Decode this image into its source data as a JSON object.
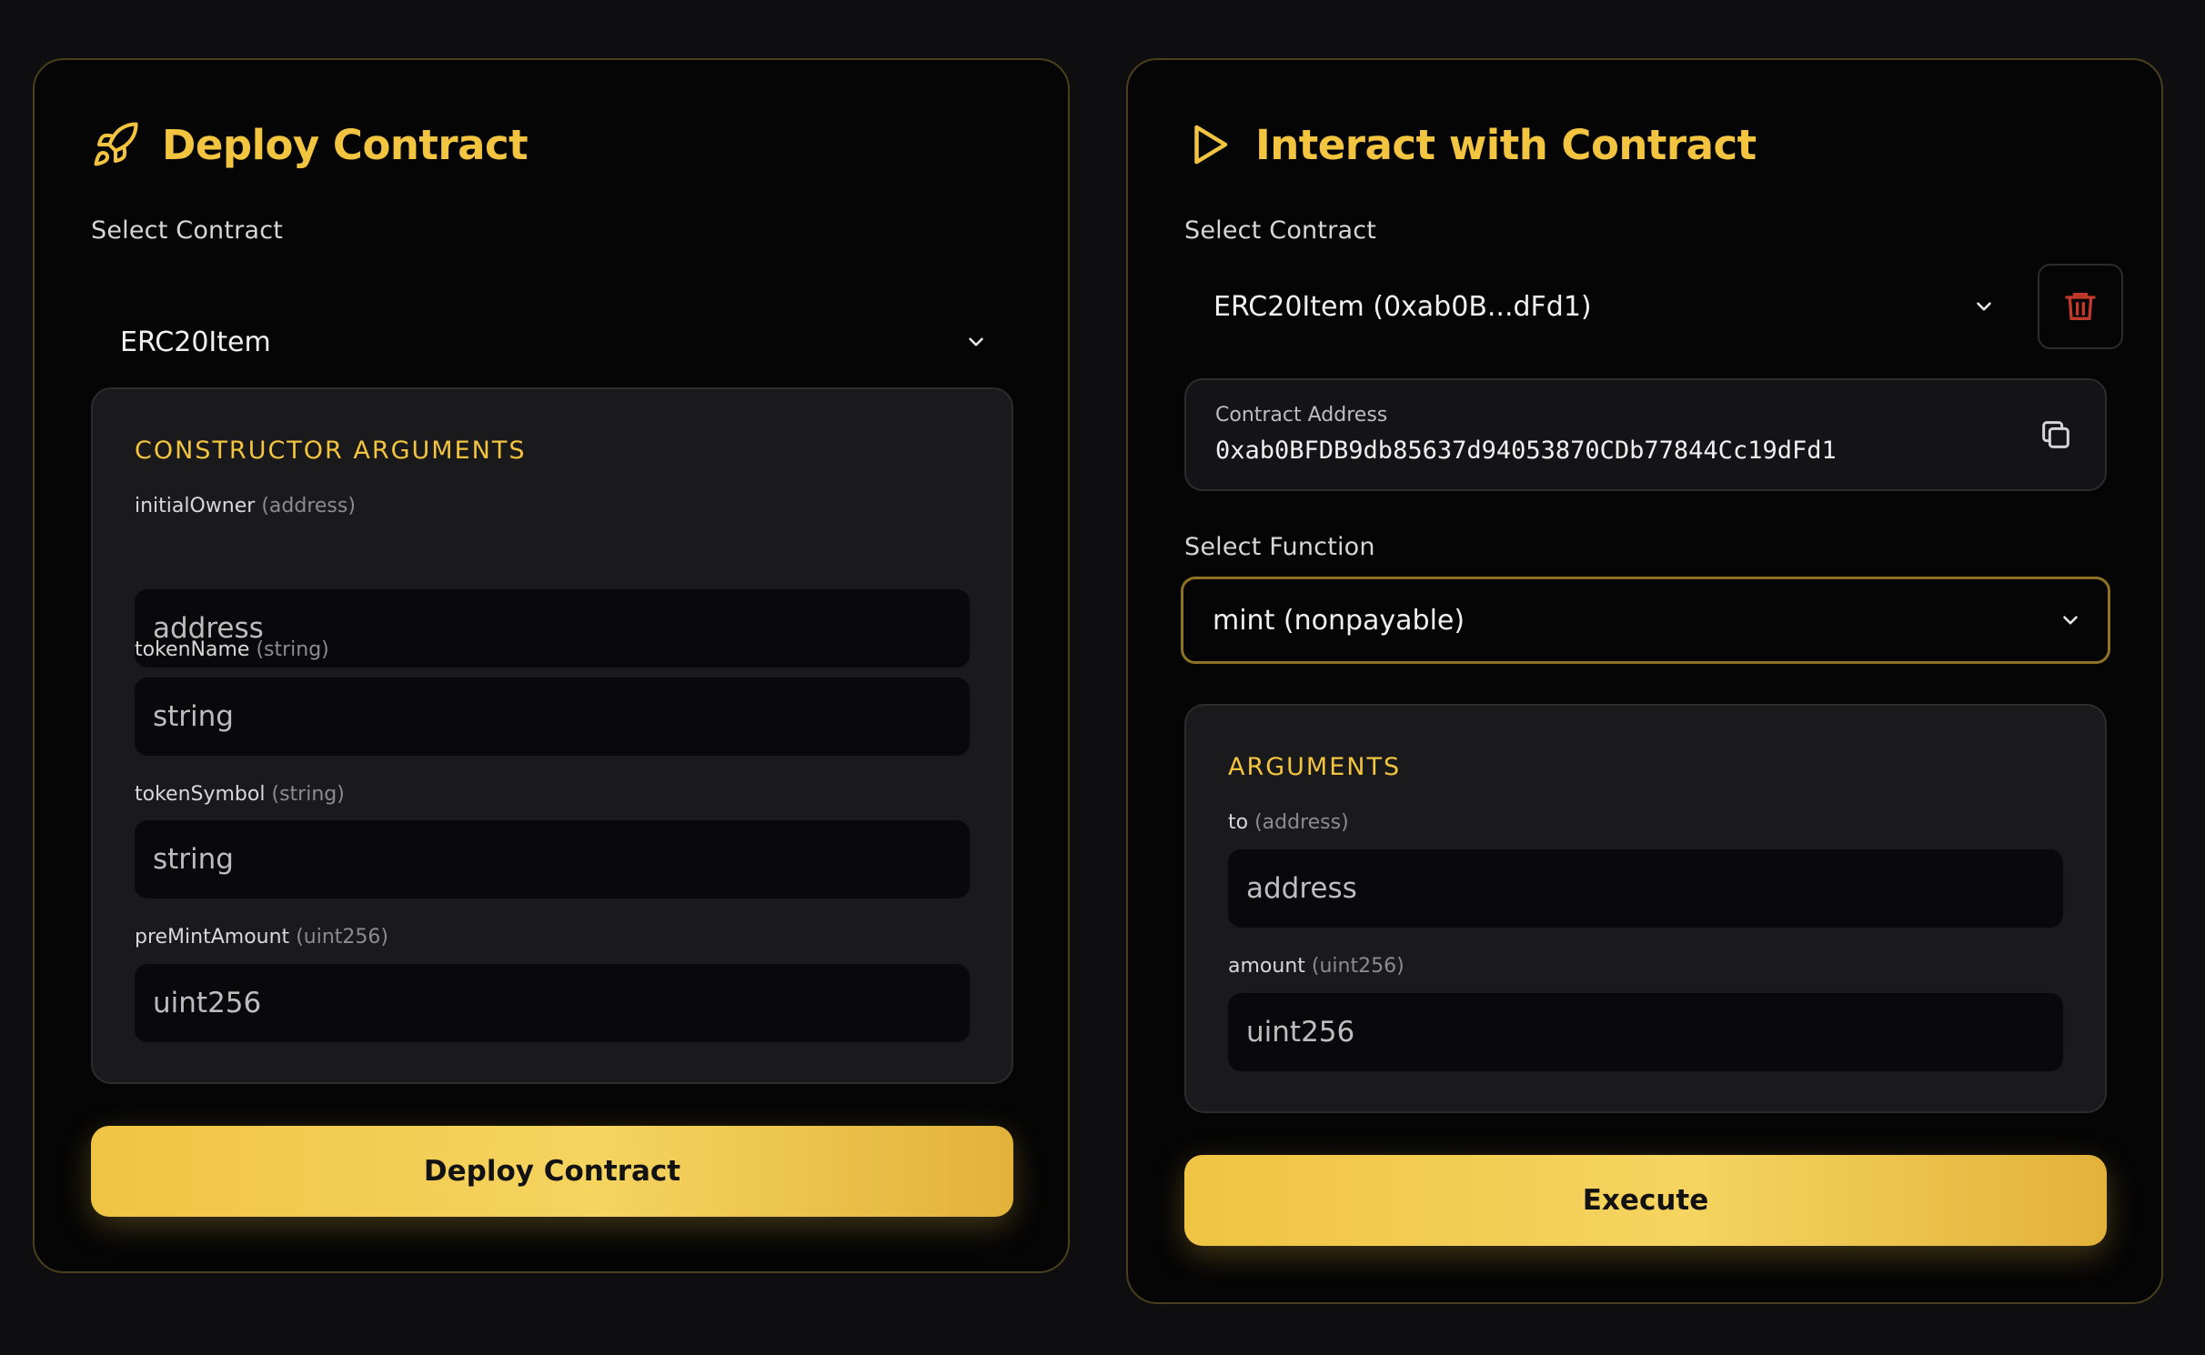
{
  "deploy": {
    "title": "Deploy Contract",
    "icon": "rocket-icon",
    "select_label": "Select Contract",
    "selected_contract": "ERC20Item",
    "args_title": "CONSTRUCTOR ARGUMENTS",
    "args": [
      {
        "name": "initialOwner",
        "type": "(address)",
        "placeholder": "address"
      },
      {
        "name": "tokenName",
        "type": "(string)",
        "placeholder": "string"
      },
      {
        "name": "tokenSymbol",
        "type": "(string)",
        "placeholder": "string"
      },
      {
        "name": "preMintAmount",
        "type": "(uint256)",
        "placeholder": "uint256"
      }
    ],
    "button_label": "Deploy Contract"
  },
  "interact": {
    "title": "Interact with Contract",
    "icon": "play-icon",
    "select_label": "Select Contract",
    "selected_contract": "ERC20Item (0xab0B...dFd1)",
    "delete_icon": "trash-icon",
    "address_caption": "Contract Address",
    "address_value": "0xab0BFDB9db85637d94053870CDb77844Cc19dFd1",
    "copy_icon": "copy-icon",
    "function_label": "Select Function",
    "selected_function": "mint (nonpayable)",
    "args_title": "ARGUMENTS",
    "args": [
      {
        "name": "to",
        "type": "(address)",
        "placeholder": "address"
      },
      {
        "name": "amount",
        "type": "(uint256)",
        "placeholder": "uint256"
      }
    ],
    "button_label": "Execute"
  },
  "colors": {
    "accent": "#f2c440",
    "background": "#0e0e10",
    "panel": "#050506",
    "panel_border": "#4a3f1c",
    "args_box": "#1a1a1c",
    "danger": "#c0392b"
  }
}
